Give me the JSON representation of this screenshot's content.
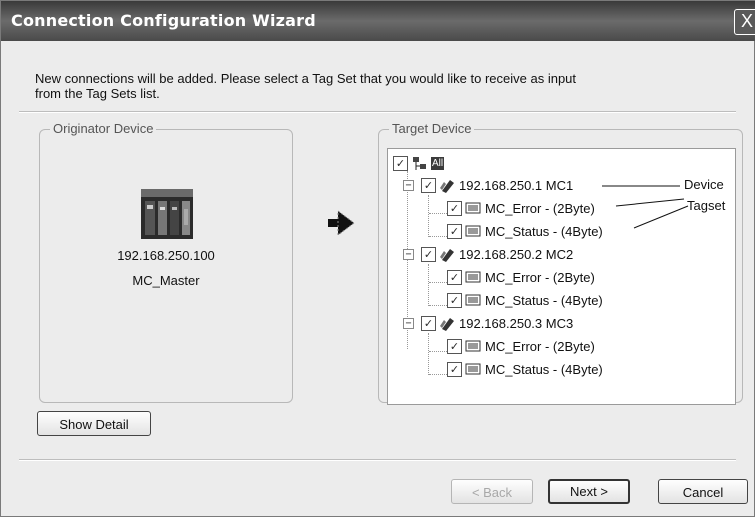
{
  "window": {
    "title": "Connection Configuration Wizard",
    "close_glyph": "X"
  },
  "intro": {
    "line1": "New connections will be added. Please select a Tag Set that you would like to receive as input",
    "line2": "from the Tag Sets list."
  },
  "originator": {
    "group_label": "Originator Device",
    "ip": "192.168.250.100",
    "name": "MC_Master",
    "icon": "plc-device-icon"
  },
  "target": {
    "group_label": "Target Device",
    "root_label": "All",
    "devices": [
      {
        "label": "192.168.250.1 MC1",
        "tagsets": [
          "MC_Error - (2Byte)",
          "MC_Status - (4Byte)"
        ]
      },
      {
        "label": "192.168.250.2 MC2",
        "tagsets": [
          "MC_Error - (2Byte)",
          "MC_Status - (4Byte)"
        ]
      },
      {
        "label": "192.168.250.3 MC3",
        "tagsets": [
          "MC_Error - (2Byte)",
          "MC_Status - (4Byte)"
        ]
      }
    ],
    "expand_glyph": "−",
    "check_glyph": "✓"
  },
  "annotations": {
    "device": "Device",
    "tagset": "Tagset"
  },
  "buttons": {
    "show_detail": "Show Detail",
    "back": "< Back",
    "next": "Next >",
    "cancel": "Cancel"
  }
}
